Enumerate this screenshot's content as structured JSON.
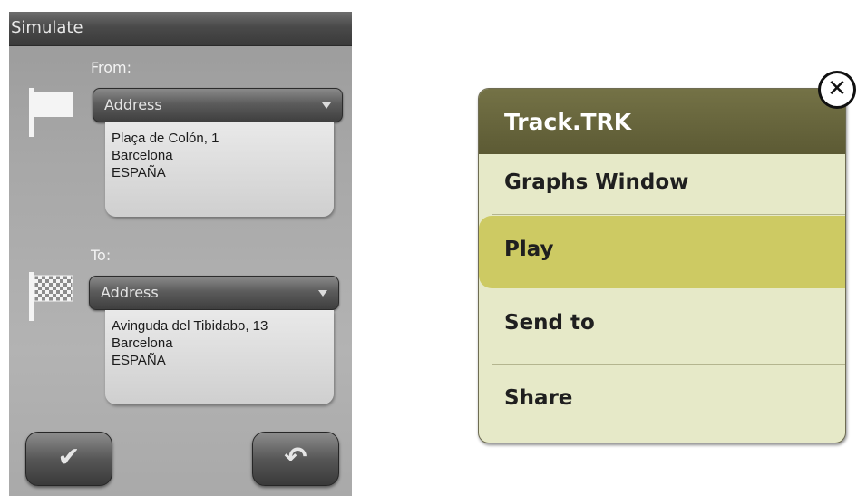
{
  "simulate": {
    "title": "Simulate",
    "from": {
      "label": "From:",
      "type": "Address",
      "address_lines": [
        "Plaça de Colón, 1",
        "Barcelona",
        "ESPAÑA"
      ]
    },
    "to": {
      "label": "To:",
      "type": "Address",
      "address_lines": [
        "Avinguda del Tibidabo, 13",
        "Barcelona",
        "ESPAÑA"
      ]
    },
    "ok_glyph": "✔",
    "back_glyph": "↶"
  },
  "track_menu": {
    "title": "Track.TRK",
    "items": [
      {
        "label": "Graphs Window",
        "selected": false
      },
      {
        "label": "Play",
        "selected": true
      },
      {
        "label": "Send to",
        "selected": false
      },
      {
        "label": "Share",
        "selected": false
      }
    ],
    "close_glyph": "✕",
    "colors": {
      "header": "#5c5a34",
      "menu_bg": "#e6e9c8",
      "selected": "#cdca63"
    }
  }
}
